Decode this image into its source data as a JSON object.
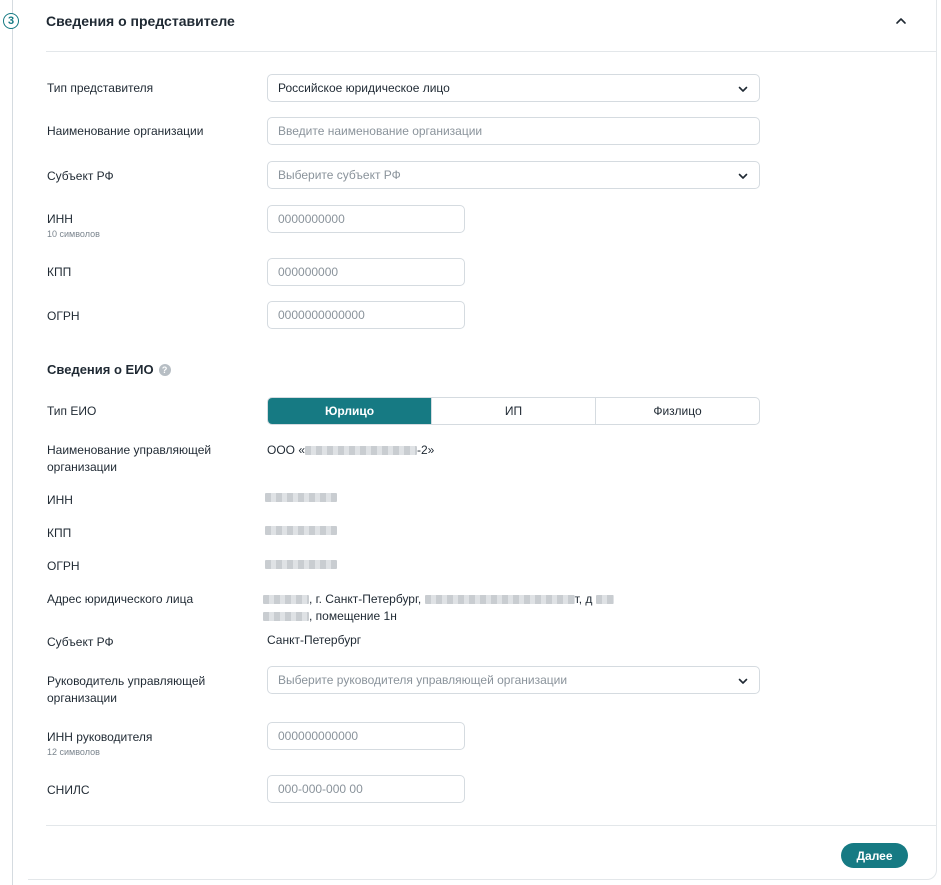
{
  "step": {
    "number": "3"
  },
  "section": {
    "title": "Сведения о представителе"
  },
  "representative": {
    "type_label": "Тип представителя",
    "type_value": "Российское юридическое лицо",
    "org_name_label": "Наименование организации",
    "org_name_placeholder": "Введите наименование организации",
    "region_label": "Субъект РФ",
    "region_placeholder": "Выберите субъект РФ",
    "inn_label": "ИНН",
    "inn_hint": "10 символов",
    "inn_placeholder": "0000000000",
    "kpp_label": "КПП",
    "kpp_placeholder": "000000000",
    "ogrn_label": "ОГРН",
    "ogrn_placeholder": "0000000000000"
  },
  "eio": {
    "title": "Сведения о ЕИО",
    "help_glyph": "?",
    "type_label": "Тип ЕИО",
    "type_options": [
      "Юрлицо",
      "ИП",
      "Физлицо"
    ],
    "type_selected": "Юрлицо",
    "mgmt_org_label": "Наименование управляющей организации",
    "mgmt_org_prefix": "ООО «",
    "mgmt_org_suffix": "-2»",
    "inn_label": "ИНН",
    "kpp_label": "КПП",
    "ogrn_label": "ОГРН",
    "address_label": "Адрес юридического лица",
    "address_part1": ", г. Санкт-Петербург,",
    "address_part2": "т, д",
    "address_part3": ", помещение 1н",
    "region_label": "Субъект РФ",
    "region_value": "Санкт-Петербург",
    "head_label": "Руководитель управляющей организации",
    "head_placeholder": "Выберите руководителя управляющей организации",
    "head_inn_label": "ИНН руководителя",
    "head_inn_hint": "12 символов",
    "head_inn_placeholder": "000000000000",
    "snils_label": "СНИЛС",
    "snils_placeholder": "000-000-000 00"
  },
  "actions": {
    "next_label": "Далее"
  },
  "colors": {
    "accent": "#167a83",
    "border": "#d5dbe0"
  }
}
